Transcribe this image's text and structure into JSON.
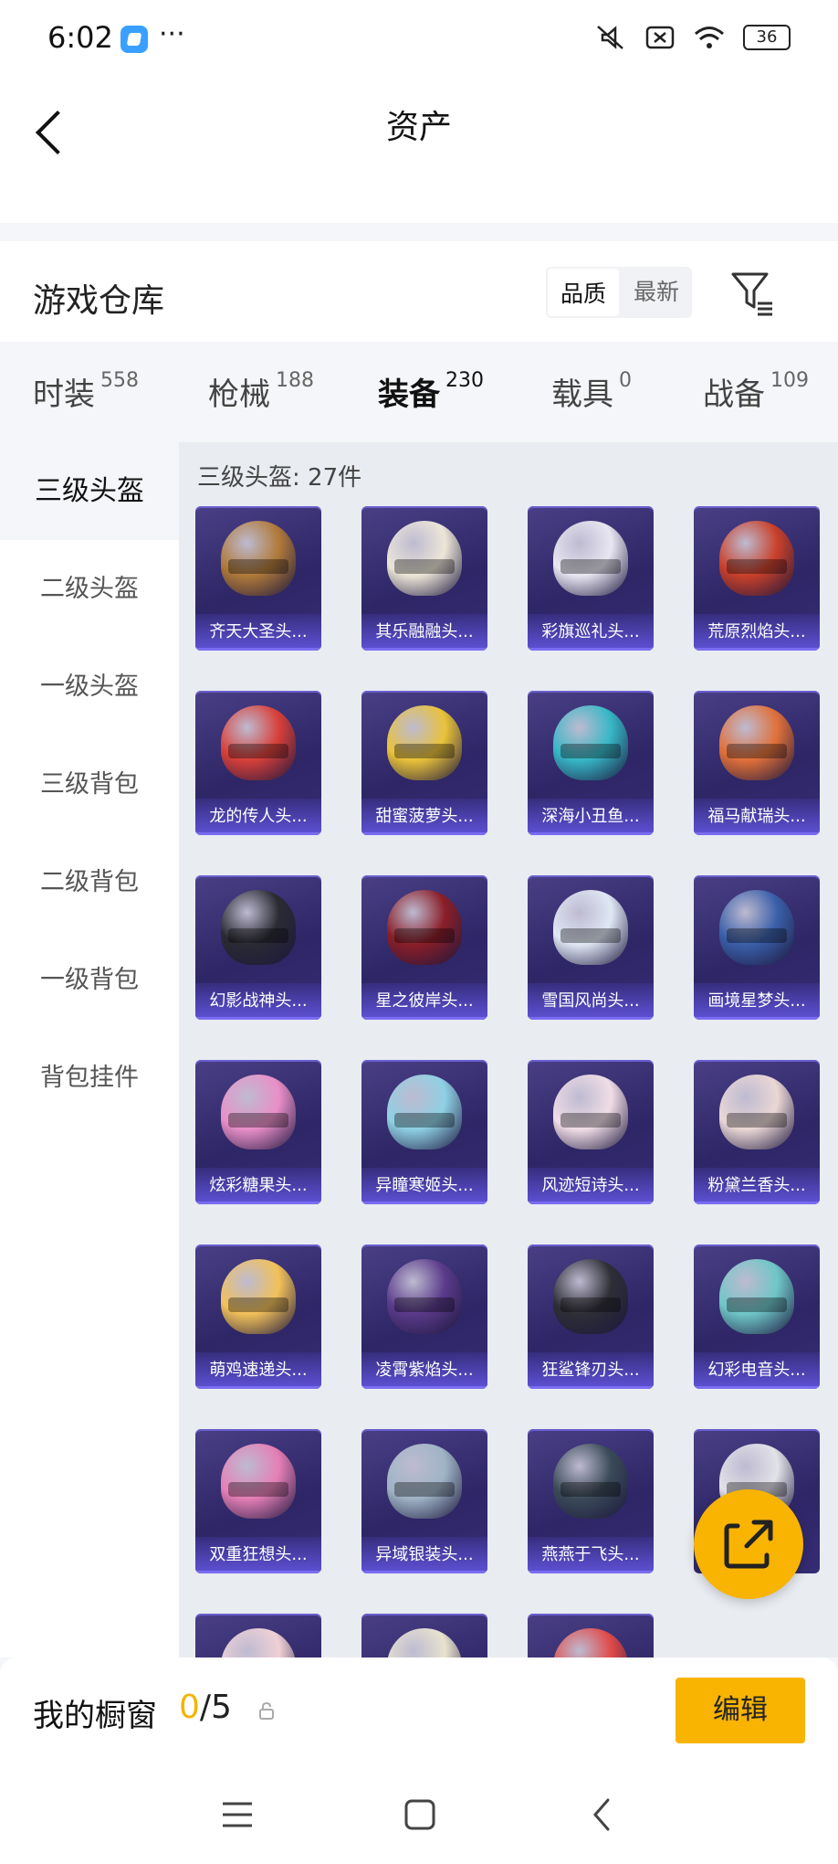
{
  "status_bar": {
    "time": "6:02",
    "more_dots": "···",
    "battery": "36",
    "icons": [
      "app-icon",
      "mute-icon",
      "sim-off-icon",
      "wifi-icon",
      "battery-icon"
    ]
  },
  "header": {
    "title": "资产",
    "back_icon": "chevron-left-icon"
  },
  "warehouse": {
    "title": "游戏仓库",
    "sort_options": [
      "品质",
      "最新"
    ],
    "sort_selected": "品质",
    "filter_icon": "filter-icon"
  },
  "tabs": [
    {
      "label": "时装",
      "count": "558"
    },
    {
      "label": "枪械",
      "count": "188"
    },
    {
      "label": "装备",
      "count": "230",
      "active": true
    },
    {
      "label": "载具",
      "count": "0"
    },
    {
      "label": "战备",
      "count": "109"
    }
  ],
  "sidebar": {
    "items": [
      {
        "label": "三级头盔",
        "active": true
      },
      {
        "label": "二级头盔"
      },
      {
        "label": "一级头盔"
      },
      {
        "label": "三级背包"
      },
      {
        "label": "二级背包"
      },
      {
        "label": "一级背包"
      },
      {
        "label": "背包挂件"
      }
    ]
  },
  "main": {
    "section_title": "三级头盔: 27件",
    "items": [
      {
        "name": "齐天大圣头...",
        "color": "#b07a3a"
      },
      {
        "name": "其乐融融头...",
        "color": "#ece6d8"
      },
      {
        "name": "彩旗巡礼头...",
        "color": "#e9e6f2"
      },
      {
        "name": "荒原烈焰头...",
        "color": "#c9402a"
      },
      {
        "name": "龙的传人头...",
        "color": "#d8403a"
      },
      {
        "name": "甜蜜菠萝头...",
        "color": "#e9c23a"
      },
      {
        "name": "深海小丑鱼...",
        "color": "#37b7c6"
      },
      {
        "name": "福马献瑞头...",
        "color": "#e0703a"
      },
      {
        "name": "幻影战神头...",
        "color": "#2a2a33"
      },
      {
        "name": "星之彼岸头...",
        "color": "#8a1e28"
      },
      {
        "name": "雪国风尚头...",
        "color": "#dfe7f4"
      },
      {
        "name": "画境星梦头...",
        "color": "#3a5fa8"
      },
      {
        "name": "炫彩糖果头...",
        "color": "#e98fc8"
      },
      {
        "name": "异瞳寒姬头...",
        "color": "#8fd0e4"
      },
      {
        "name": "风迹短诗头...",
        "color": "#f0dde6"
      },
      {
        "name": "粉黛兰香头...",
        "color": "#ead7d5"
      },
      {
        "name": "萌鸡速递头...",
        "color": "#f2c15a"
      },
      {
        "name": "凌霄紫焰头...",
        "color": "#5a3a8a"
      },
      {
        "name": "狂鲨锋刃头...",
        "color": "#2e2e36"
      },
      {
        "name": "幻彩电音头...",
        "color": "#6fc6c7"
      },
      {
        "name": "双重狂想头...",
        "color": "#e57fb6"
      },
      {
        "name": "异域银装头...",
        "color": "#9fb4c6"
      },
      {
        "name": "燕燕于飞头...",
        "color": "#3a4a58"
      },
      {
        "name": "",
        "color": "#e2e2e8"
      },
      {
        "name": "",
        "color": "#f0d0d6"
      },
      {
        "name": "",
        "color": "#e8e2cf"
      },
      {
        "name": "",
        "color": "#e04a4a"
      }
    ]
  },
  "fab": {
    "icon": "share-icon"
  },
  "showcase": {
    "title": "我的橱窗",
    "current": "0",
    "separator": "/",
    "total": "5",
    "lock_icon": "lock-icon",
    "edit_label": "编辑",
    "accent": "#F8B400"
  },
  "nav_bar": {
    "icons": [
      "menu-icon",
      "home-icon",
      "back-icon"
    ]
  }
}
